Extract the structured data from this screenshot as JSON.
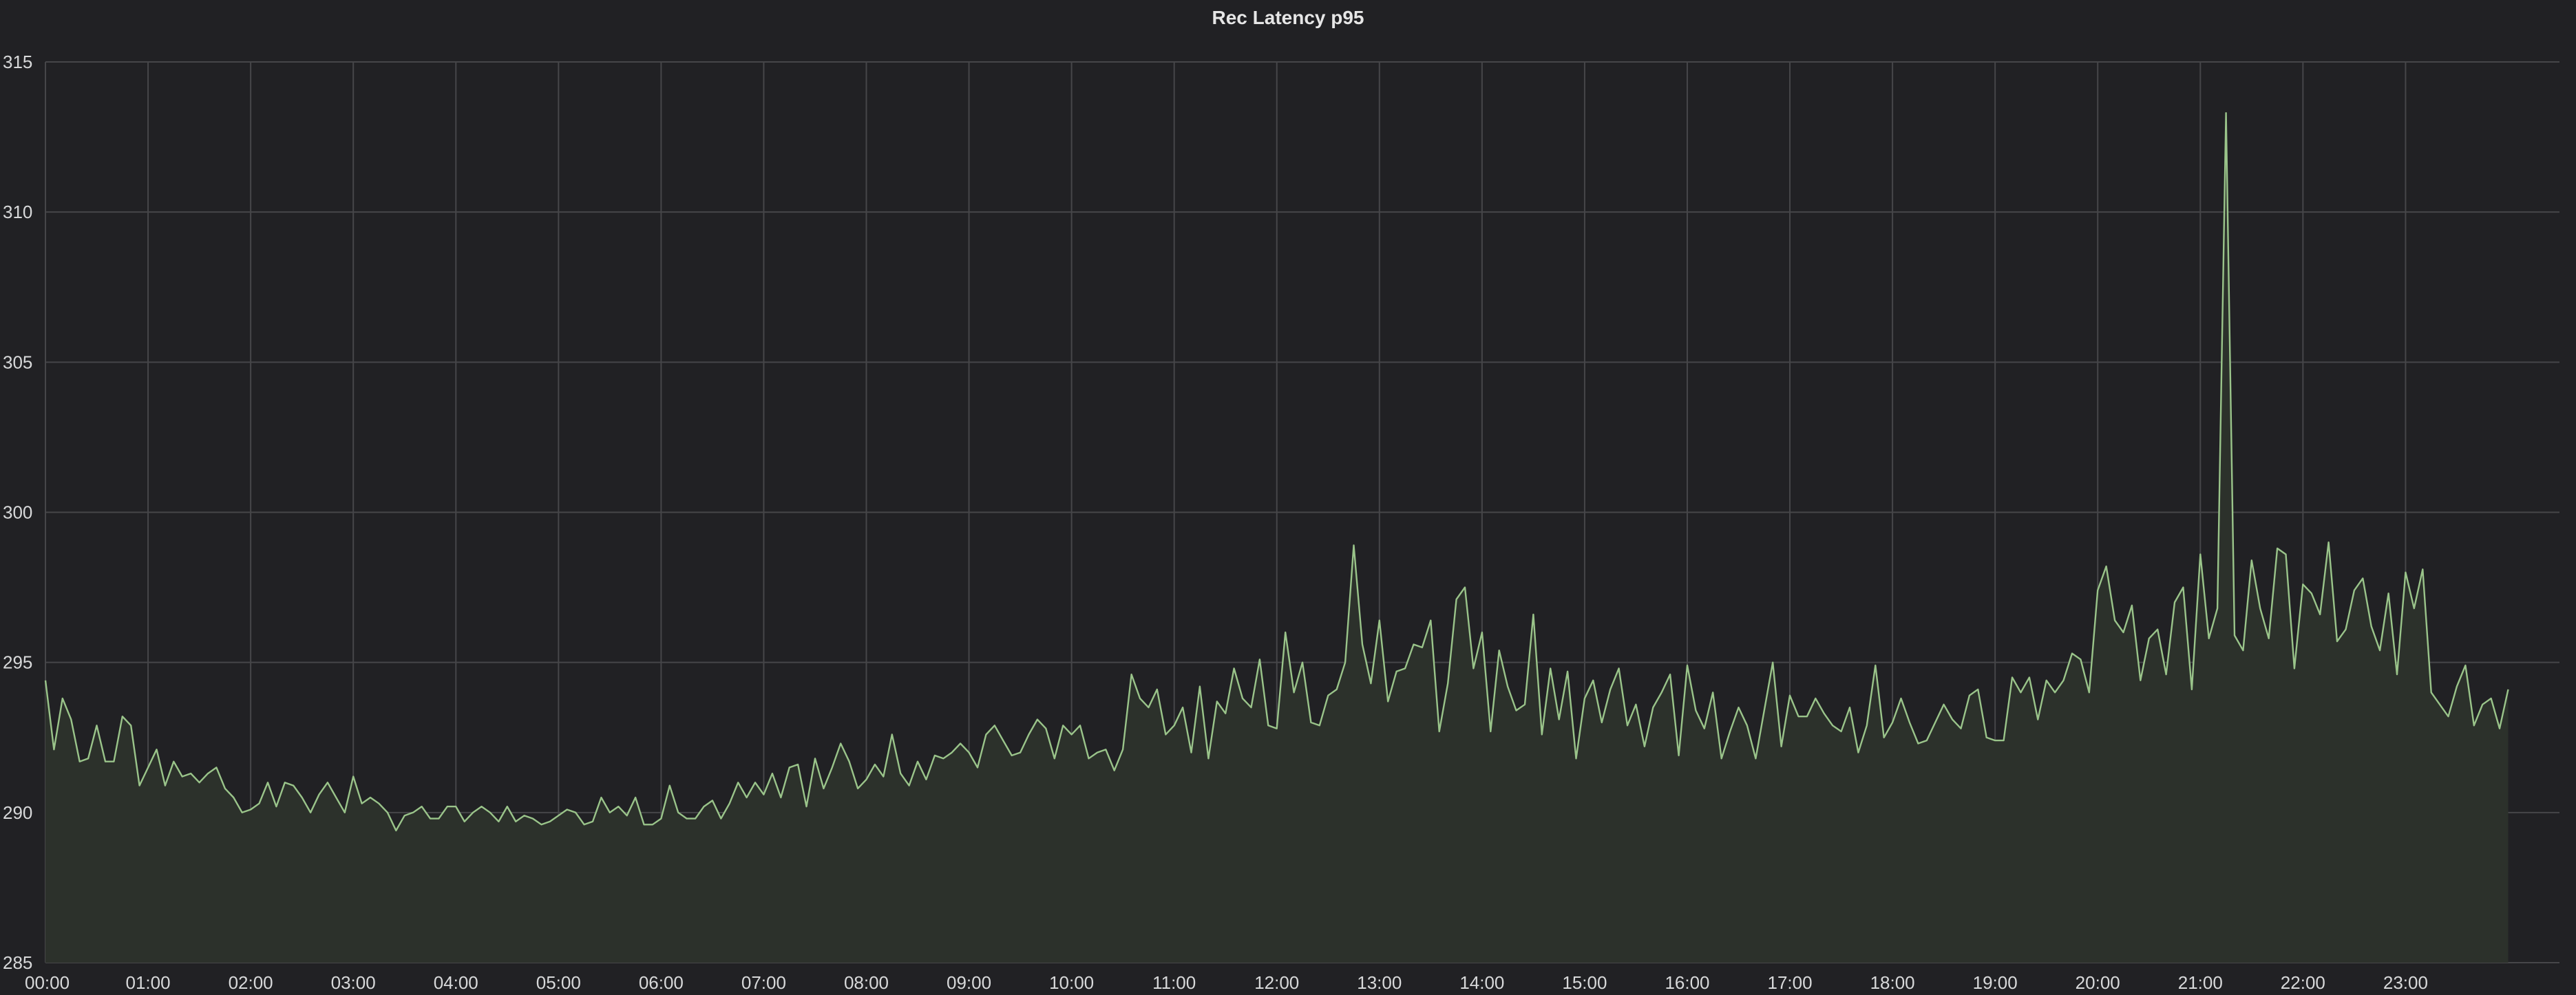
{
  "panel": {
    "title": "Rec Latency p95"
  },
  "chart_data": {
    "type": "area",
    "title": "Rec Latency p95",
    "xlabel": "",
    "ylabel": "",
    "ylim": [
      285,
      315
    ],
    "xlim_hours": [
      0,
      24.5
    ],
    "y_ticks": [
      "285",
      "290",
      "295",
      "300",
      "305",
      "310",
      "315"
    ],
    "x_ticks": [
      "00:00",
      "01:00",
      "02:00",
      "03:00",
      "04:00",
      "05:00",
      "06:00",
      "07:00",
      "08:00",
      "09:00",
      "10:00",
      "11:00",
      "12:00",
      "13:00",
      "14:00",
      "15:00",
      "16:00",
      "17:00",
      "18:00",
      "19:00",
      "20:00",
      "21:00",
      "22:00",
      "23:00"
    ],
    "grid": true,
    "sample_interval_minutes": 5,
    "colors": {
      "line": "#9ac48a",
      "fill": "#2c312b",
      "grid": "#464649",
      "background": "#212124"
    },
    "series": [
      {
        "values": [
          294.4,
          292.1,
          293.8,
          293.1,
          291.7,
          291.8,
          292.9,
          291.7,
          291.7,
          293.2,
          292.9,
          290.9,
          291.5,
          292.1,
          290.9,
          291.7,
          291.2,
          291.3,
          291.0,
          291.3,
          291.5,
          290.8,
          290.5,
          290.0,
          290.1,
          290.3,
          291.0,
          290.2,
          291.0,
          290.9,
          290.5,
          290.0,
          290.6,
          291.0,
          290.5,
          290.0,
          291.2,
          290.3,
          290.5,
          290.3,
          290.0,
          289.4,
          289.9,
          290.0,
          290.2,
          289.8,
          289.8,
          290.2,
          290.2,
          289.7,
          290.0,
          290.2,
          290.0,
          289.7,
          290.2,
          289.7,
          289.9,
          289.8,
          289.6,
          289.7,
          289.9,
          290.1,
          290.0,
          289.6,
          289.7,
          290.5,
          290.0,
          290.2,
          289.9,
          290.5,
          289.6,
          289.6,
          289.8,
          290.9,
          290.0,
          289.8,
          289.8,
          290.2,
          290.4,
          289.8,
          290.3,
          291.0,
          290.5,
          291.0,
          290.6,
          291.3,
          290.5,
          291.5,
          291.6,
          290.2,
          291.8,
          290.8,
          291.5,
          292.3,
          291.7,
          290.8,
          291.1,
          291.6,
          291.2,
          292.6,
          291.3,
          290.9,
          291.7,
          291.1,
          291.9,
          291.8,
          292.0,
          292.3,
          292.0,
          291.5,
          292.6,
          292.9,
          292.4,
          291.9,
          292.0,
          292.6,
          293.1,
          292.8,
          291.8,
          292.9,
          292.6,
          292.9,
          291.8,
          292.0,
          292.1,
          291.4,
          292.1,
          294.6,
          293.8,
          293.5,
          294.1,
          292.6,
          292.9,
          293.5,
          292.0,
          294.2,
          291.8,
          293.7,
          293.3,
          294.8,
          293.8,
          293.5,
          295.1,
          292.9,
          292.8,
          296.0,
          294.0,
          295.0,
          293.0,
          292.9,
          293.9,
          294.1,
          295.0,
          298.9,
          295.6,
          294.3,
          296.4,
          293.7,
          294.7,
          294.8,
          295.6,
          295.5,
          296.4,
          292.7,
          294.3,
          297.1,
          297.5,
          294.8,
          296.0,
          292.7,
          295.4,
          294.2,
          293.4,
          293.6,
          296.6,
          292.6,
          294.8,
          293.1,
          294.7,
          291.8,
          293.8,
          294.4,
          293.0,
          294.1,
          294.8,
          292.9,
          293.6,
          292.2,
          293.5,
          294.0,
          294.6,
          291.9,
          294.9,
          293.4,
          292.8,
          294.0,
          291.8,
          292.7,
          293.5,
          292.9,
          291.8,
          293.4,
          295.0,
          292.2,
          293.9,
          293.2,
          293.2,
          293.8,
          293.3,
          292.9,
          292.7,
          293.5,
          292.0,
          292.9,
          294.9,
          292.5,
          293.0,
          293.8,
          293.0,
          292.3,
          292.4,
          293.0,
          293.6,
          293.1,
          292.8,
          293.9,
          294.1,
          292.5,
          292.4,
          292.4,
          294.5,
          294.0,
          294.5,
          293.1,
          294.4,
          294.0,
          294.4,
          295.3,
          295.1,
          294.0,
          297.4,
          298.2,
          296.4,
          296.0,
          296.9,
          294.4,
          295.8,
          296.1,
          294.6,
          297.0,
          297.5,
          294.1,
          298.6,
          295.8,
          296.8,
          313.3,
          295.9,
          295.4,
          298.4,
          296.8,
          295.8,
          298.8,
          298.6,
          294.8,
          297.6,
          297.3,
          296.6,
          299.0,
          295.7,
          296.1,
          297.4,
          297.8,
          296.2,
          295.4,
          297.3,
          294.6,
          298.0,
          296.8,
          298.1,
          294.0,
          293.6,
          293.2,
          294.2,
          294.9,
          292.9,
          293.6,
          293.8,
          292.8,
          294.1
        ]
      }
    ]
  }
}
